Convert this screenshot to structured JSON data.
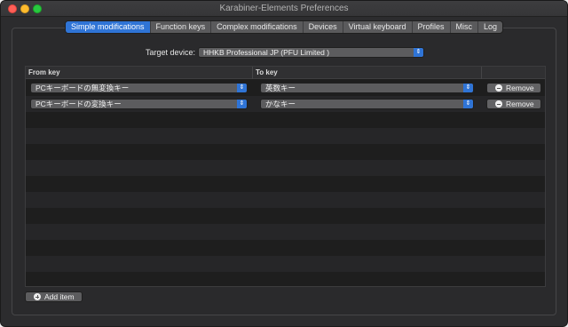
{
  "window": {
    "title": "Karabiner-Elements Preferences"
  },
  "tabs": [
    {
      "label": "Simple modifications",
      "active": true
    },
    {
      "label": "Function keys",
      "active": false
    },
    {
      "label": "Complex modifications",
      "active": false
    },
    {
      "label": "Devices",
      "active": false
    },
    {
      "label": "Virtual keyboard",
      "active": false
    },
    {
      "label": "Profiles",
      "active": false
    },
    {
      "label": "Misc",
      "active": false
    },
    {
      "label": "Log",
      "active": false
    }
  ],
  "target": {
    "label": "Target device:",
    "value": "HHKB Professional JP (PFU Limited )"
  },
  "table": {
    "headers": {
      "from": "From key",
      "to": "To key"
    },
    "rows": [
      {
        "from": "PCキーボードの無変換キー",
        "to": "英数キー",
        "remove": "Remove"
      },
      {
        "from": "PCキーボードの変換キー",
        "to": "かなキー",
        "remove": "Remove"
      }
    ]
  },
  "add_item": "Add item",
  "icons": {
    "popup_arrows": "updown-chevron-icon",
    "remove": "minus-circle-icon",
    "add": "plus-circle-icon"
  }
}
